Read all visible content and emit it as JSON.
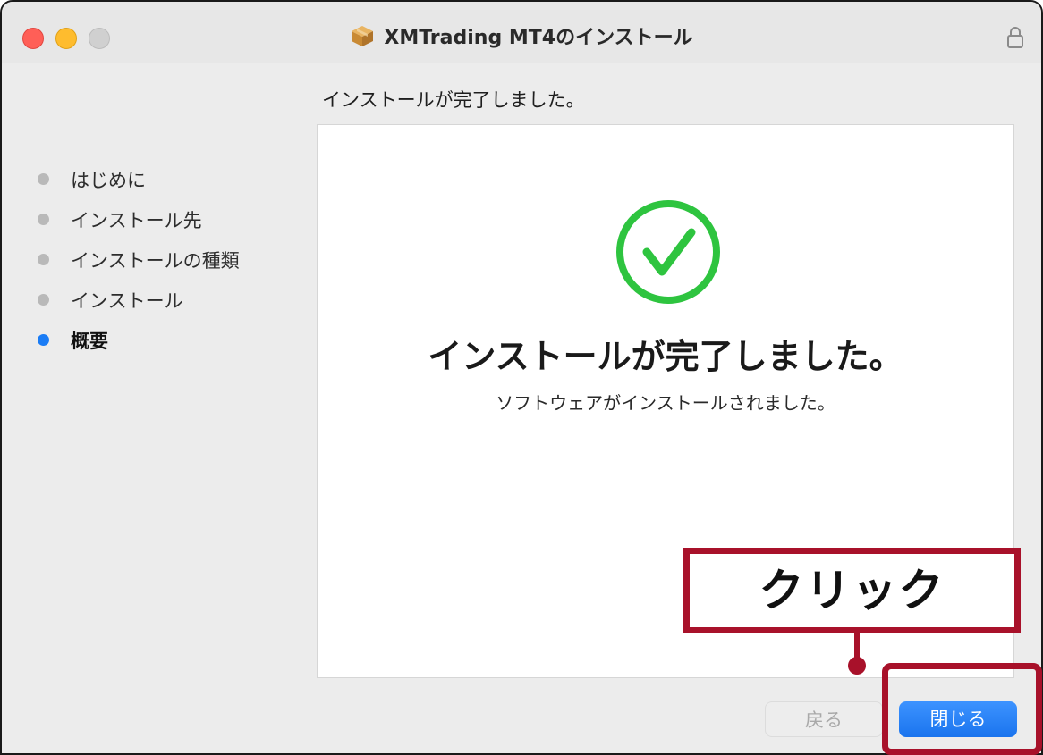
{
  "window": {
    "title": "XMTrading MT4のインストール",
    "title_icon": "package-icon",
    "lock_icon": "lock-icon"
  },
  "header": {
    "text": "インストールが完了しました。"
  },
  "sidebar": {
    "items": [
      {
        "label": "はじめに",
        "active": false
      },
      {
        "label": "インストール先",
        "active": false
      },
      {
        "label": "インストールの種類",
        "active": false
      },
      {
        "label": "インストール",
        "active": false
      },
      {
        "label": "概要",
        "active": true
      }
    ]
  },
  "content": {
    "icon": "checkmark-circle-icon",
    "headline": "インストールが完了しました。",
    "message": "ソフトウェアがインストールされました。"
  },
  "buttons": {
    "back_label": "戻る",
    "close_label": "閉じる"
  },
  "annotation": {
    "callout_text": "クリック"
  },
  "colors": {
    "accent": "#1a7cf5",
    "success": "#2ec43f",
    "annotation": "#a8112a"
  }
}
